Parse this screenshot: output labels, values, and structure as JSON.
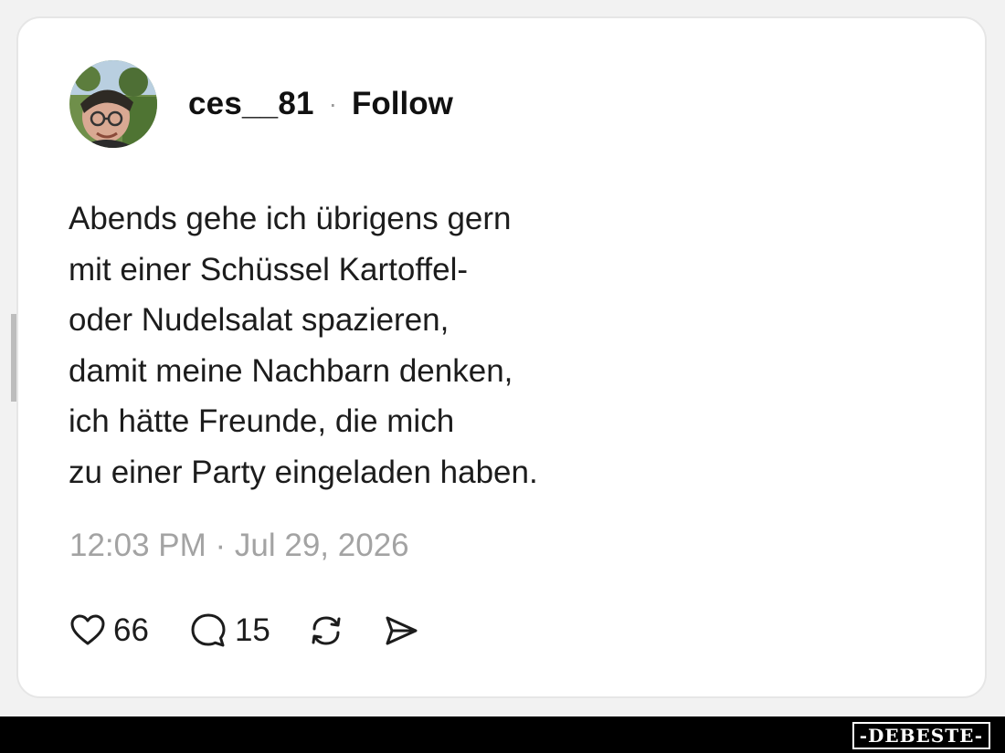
{
  "post": {
    "username": "ces__81",
    "separator": "·",
    "follow_label": "Follow",
    "avatar_icon": "profile-photo",
    "text_lines": [
      "Abends gehe ich übrigens gern",
      "mit einer Schüssel Kartoffel-",
      "oder Nudelsalat spazieren,",
      "damit meine Nachbarn denken,",
      "ich hätte Freunde, die mich",
      "zu einer Party eingeladen haben."
    ],
    "timestamp": "12:03 PM · Jul 29, 2026",
    "likes": "66",
    "comments": "15",
    "icons": {
      "like": "heart-icon",
      "comment": "comment-bubble-icon",
      "repost": "repost-icon",
      "share": "send-icon"
    }
  },
  "watermark": {
    "side_text": "DEBESTE",
    "footer_logo": "-DEBESTE-"
  },
  "colors": {
    "text": "#1c1c1c",
    "muted": "#a3a3a3",
    "card_border": "#e6e6e6",
    "footer": "#000000"
  }
}
